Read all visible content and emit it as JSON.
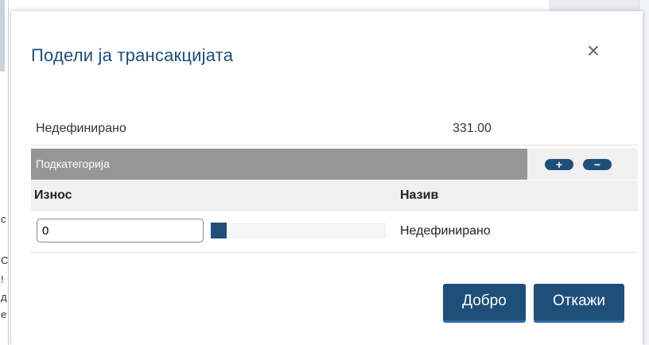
{
  "background": {
    "fragments": [
      "c",
      "C",
      "!",
      "д",
      "e"
    ],
    "bottom_text": "..."
  },
  "dialog": {
    "title": "Подели ја трансакцијата",
    "close_icon": "close-icon (×)",
    "close_glyph": "×"
  },
  "summary": {
    "category": "Недефинирано",
    "amount": "331.00"
  },
  "subcategory": {
    "label": "Подкатегорија",
    "add_glyph": "+",
    "remove_glyph": "−"
  },
  "table": {
    "headers": {
      "amount": "Износ",
      "name": "Назив"
    },
    "rows": [
      {
        "amount_value": "0",
        "name": "Недефинирано",
        "slider_fraction": 0
      }
    ]
  },
  "actions": {
    "ok_label": "Добро",
    "cancel_label": "Откажи"
  },
  "colors": {
    "accent": "#1f4e79",
    "subcategory_bar": "#969696",
    "header_bg": "#f0f0f0"
  }
}
